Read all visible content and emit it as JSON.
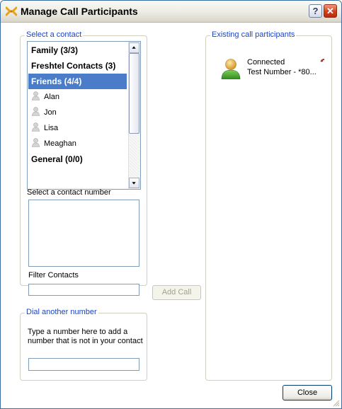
{
  "window": {
    "title": "Manage Call Participants",
    "help_label": "?",
    "close_label": "✕"
  },
  "select_contact": {
    "legend": "Select a contact",
    "rows": [
      {
        "label": "Family (3/3)",
        "kind": "header",
        "selected": false
      },
      {
        "label": "Freshtel Contacts (3)",
        "kind": "header",
        "selected": false
      },
      {
        "label": "Friends (4/4)",
        "kind": "header",
        "selected": true
      },
      {
        "label": "Alan",
        "kind": "contact",
        "selected": false
      },
      {
        "label": "Jon",
        "kind": "contact",
        "selected": false
      },
      {
        "label": "Lisa",
        "kind": "contact",
        "selected": false
      },
      {
        "label": "Meaghan",
        "kind": "contact",
        "selected": false
      },
      {
        "label": "General (0/0)",
        "kind": "header",
        "selected": false
      }
    ],
    "number_label": "Select a contact number",
    "filter_label": "Filter Contacts",
    "filter_value": ""
  },
  "add_call_label": "Add Call",
  "dial_another": {
    "legend": "Dial another number",
    "help_line1": "Type a number here to add a",
    "help_line2": "number that is not in your contact",
    "number_value": ""
  },
  "existing": {
    "legend": "Existing call participants",
    "participants": [
      {
        "status": "Connected",
        "name": "Test Number - *80..."
      }
    ]
  },
  "close_button_label": "Close",
  "colors": {
    "legend": "#1b44c0",
    "selection": "#4a7cc9",
    "field_border": "#7f9db9",
    "hangup": "#c0392b"
  },
  "icons": [
    "manage-call-icon",
    "help-icon",
    "close-icon",
    "contact-person-icon",
    "participant-avatar-icon",
    "hangup-icon",
    "scroll-up-icon",
    "scroll-down-icon",
    "resize-grip-icon"
  ]
}
